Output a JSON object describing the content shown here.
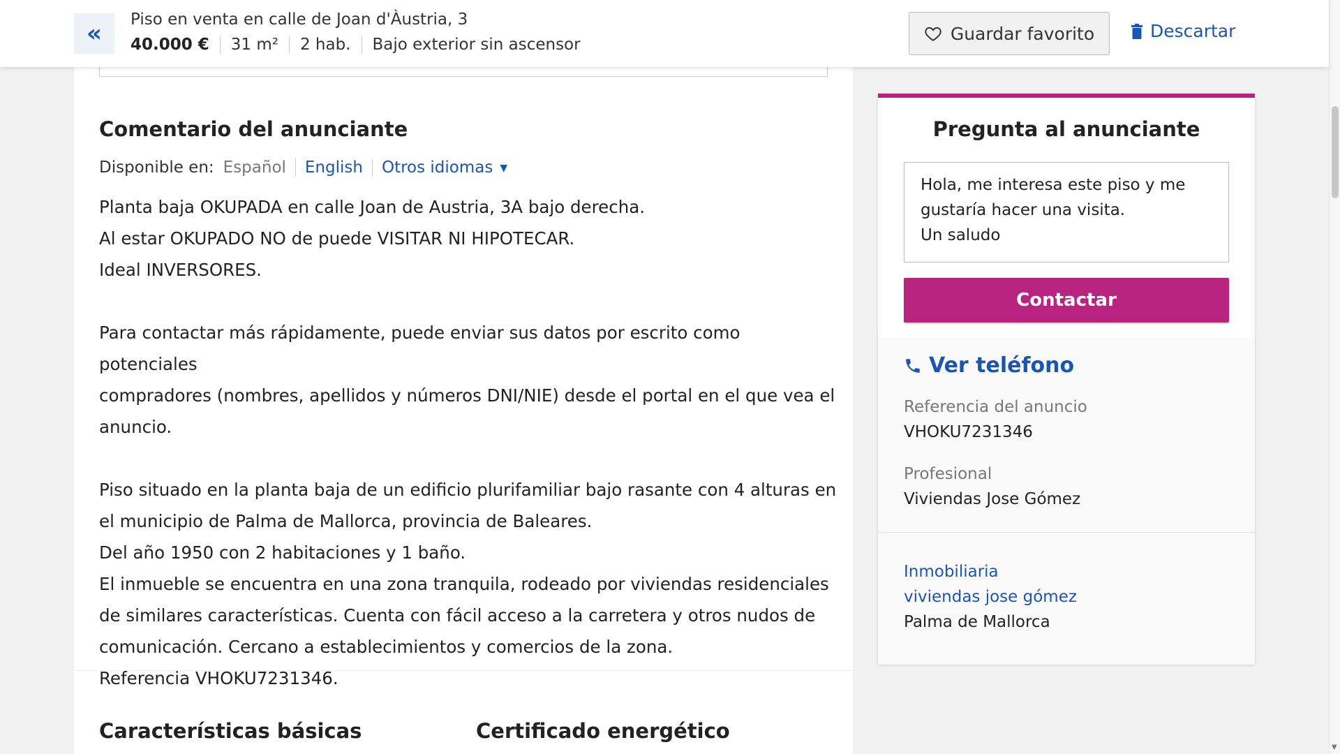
{
  "header": {
    "title": "Piso en venta en calle de Joan d'Àustria, 3",
    "price": "40.000 €",
    "area": "31 m²",
    "rooms": "2 hab.",
    "floor": "Bajo exterior sin ascensor",
    "favorite_label": "Guardar favorito",
    "discard_label": "Descartar",
    "back_icon": "double-chevron-left-icon"
  },
  "comment": {
    "title": "Comentario del anunciante",
    "available_label": "Disponible en:",
    "current_lang": "Español",
    "english": "English",
    "other_langs": "Otros idiomas",
    "lines": [
      "Planta baja OKUPADA en calle Joan de Austria, 3A bajo derecha.",
      "Al estar OKUPADO NO de puede VISITAR NI HIPOTECAR.",
      "Ideal INVERSORES.",
      "",
      "Para contactar más rápidamente, puede enviar sus datos por escrito como potenciales",
      "compradores (nombres, apellidos y números DNI/NIE) desde el portal en el que vea el",
      "anuncio.",
      "",
      "Piso situado en la planta baja de un edificio plurifamiliar bajo rasante con 4 alturas en",
      "el municipio de Palma de Mallorca, provincia de Baleares.",
      "Del año 1950 con 2 habitaciones y 1 baño.",
      "El inmueble se encuentra en una zona tranquila, rodeado por viviendas residenciales",
      "de similares características. Cuenta con fácil acceso a la carretera y otros nudos de",
      "comunicación. Cercano a establecimientos y comercios de la zona.",
      "Referencia VHOKU7231346."
    ]
  },
  "sections": {
    "basic": "Características básicas",
    "energy": "Certificado energético"
  },
  "contact": {
    "title": "Pregunta al anunciante",
    "message_lines": [
      "Hola, me interesa este piso y me",
      "gustaría hacer una visita.",
      "Un saludo"
    ],
    "contact_label": "Contactar",
    "phone_label": "Ver teléfono",
    "ref_label": "Referencia del anuncio",
    "ref_value": "VHOKU7231346",
    "pro_label": "Profesional",
    "pro_value": "Viviendas Jose Gómez",
    "agency_link_1": "Inmobiliaria",
    "agency_link_2": "viviendas jose gómez",
    "agency_city": "Palma de Mallorca"
  },
  "colors": {
    "accent": "#b8237f",
    "link": "#1a56b0"
  }
}
